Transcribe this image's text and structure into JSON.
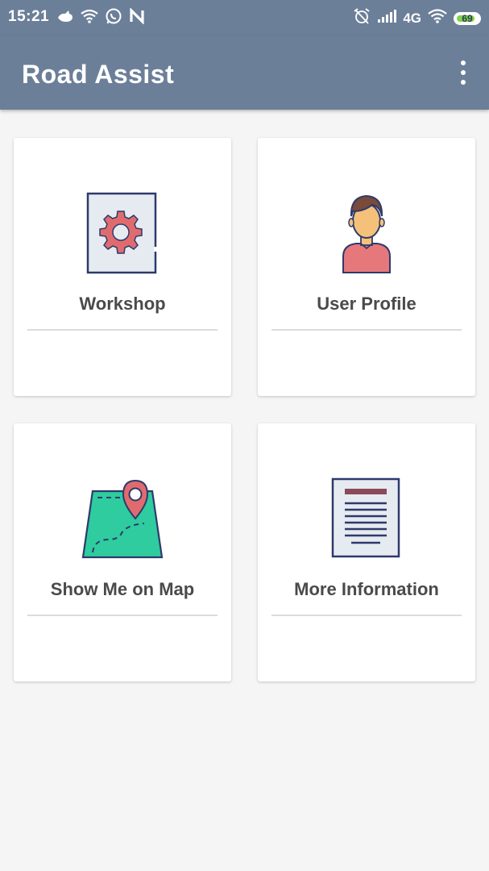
{
  "status_bar": {
    "time": "15:21",
    "network": "4G",
    "battery": "69",
    "icons_left": [
      "bird-icon",
      "wifi-icon",
      "whatsapp-icon",
      "n-icon"
    ],
    "icons_right": [
      "alarm-off-icon",
      "signal-icon",
      "wifi-icon",
      "battery-icon"
    ]
  },
  "app_bar": {
    "title": "Road Assist",
    "menu_icon": "more-vert-icon"
  },
  "cards": [
    {
      "label": "Workshop",
      "icon": "workshop-gear-icon"
    },
    {
      "label": "User Profile",
      "icon": "user-profile-icon"
    },
    {
      "label": "Show Me on Map",
      "icon": "map-pin-icon"
    },
    {
      "label": "More Information",
      "icon": "document-icon"
    }
  ],
  "colors": {
    "primary": "#6c7f99",
    "background": "#f5f5f5",
    "accent_red": "#e06b6f",
    "map_green": "#2ecc9f"
  }
}
